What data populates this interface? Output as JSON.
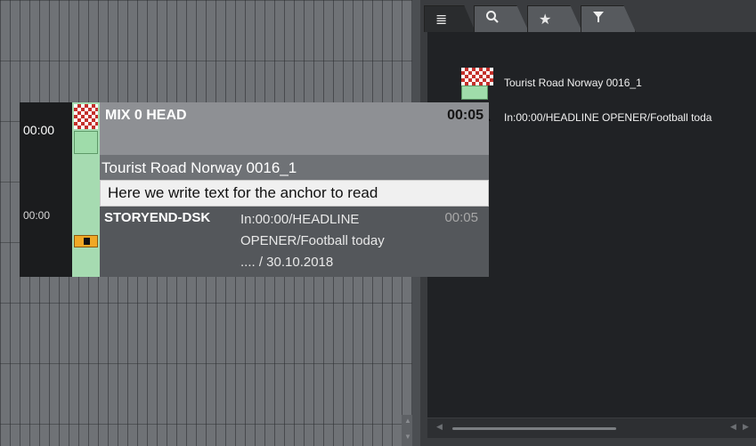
{
  "timeline": {
    "scroll_up": "▲",
    "scroll_down": "▼"
  },
  "panel": {
    "tabs": [
      {
        "icon": "list-icon",
        "glyph": "≣"
      },
      {
        "icon": "search-icon",
        "glyph": "🔍"
      },
      {
        "icon": "star-icon",
        "glyph": "★"
      },
      {
        "icon": "filter-icon",
        "glyph": "▼"
      }
    ],
    "result": {
      "title": "Tourist Road Norway 0016_1",
      "subtitle": "In:00:00/HEADLINE OPENER/Football toda"
    },
    "scroll_left": "◀",
    "scroll_right": "◀",
    "scroll_right2": "▶"
  },
  "story": {
    "time_start": "00:00",
    "time_dsk": "00:00",
    "head_label": "MIX 0 HEAD",
    "head_duration": "00:05",
    "clip_title": "Tourist Road Norway 0016_1",
    "anchor_text": "Here we write text for the anchor to read",
    "dsk_label": "STORYEND-DSK",
    "dsk_text": "In:00:00/HEADLINE OPENER/Football today .... / 30.10.2018",
    "dsk_duration": "00:05"
  },
  "colors": {
    "checker_red": "#c4302b",
    "clip_green": "#a6dbb1",
    "dsk_orange": "#f0a825"
  }
}
